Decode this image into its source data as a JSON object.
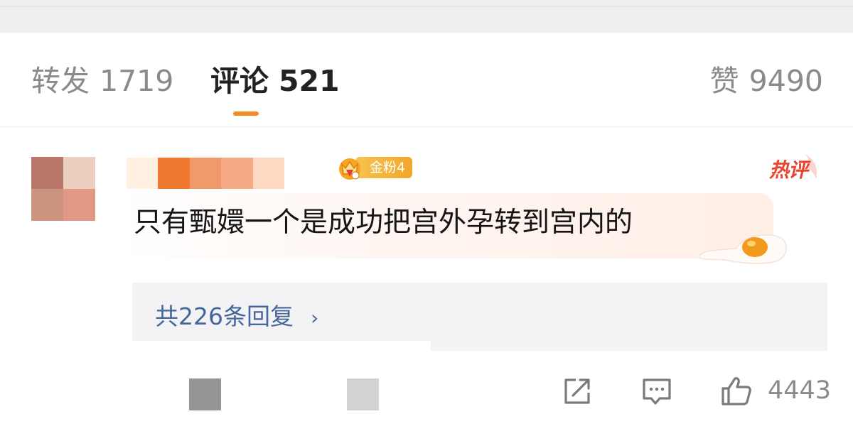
{
  "tabs": {
    "forward": {
      "label": "转发",
      "count": "1719"
    },
    "comments": {
      "label": "评论",
      "count": "521"
    },
    "likes": {
      "label": "赞",
      "count": "9490"
    }
  },
  "comment": {
    "fan_badge": "金粉4",
    "hot_tag": "热评",
    "text": "只有甄嬛一个是成功把宫外孕转到宫内的",
    "replies_label": "共226条回复",
    "replies_chevron": "›",
    "like_count": "4443",
    "avatar_colors": [
      "#b9776a",
      "#ebcfbf",
      "#cd9480",
      "#e19985"
    ],
    "username_colors": [
      "#fff0e2",
      "#ef7a2f",
      "#f2996c",
      "#f4a884",
      "#fdd8c2"
    ]
  },
  "icons": {
    "share": "share-square-icon",
    "comment": "comment-bubble-icon",
    "like": "thumbs-up-icon",
    "crown": "crown-icon",
    "egg": "fried-egg-icon"
  },
  "colors": {
    "accent": "#f78c1e",
    "link": "#46679c",
    "hot": "#e8452e"
  }
}
